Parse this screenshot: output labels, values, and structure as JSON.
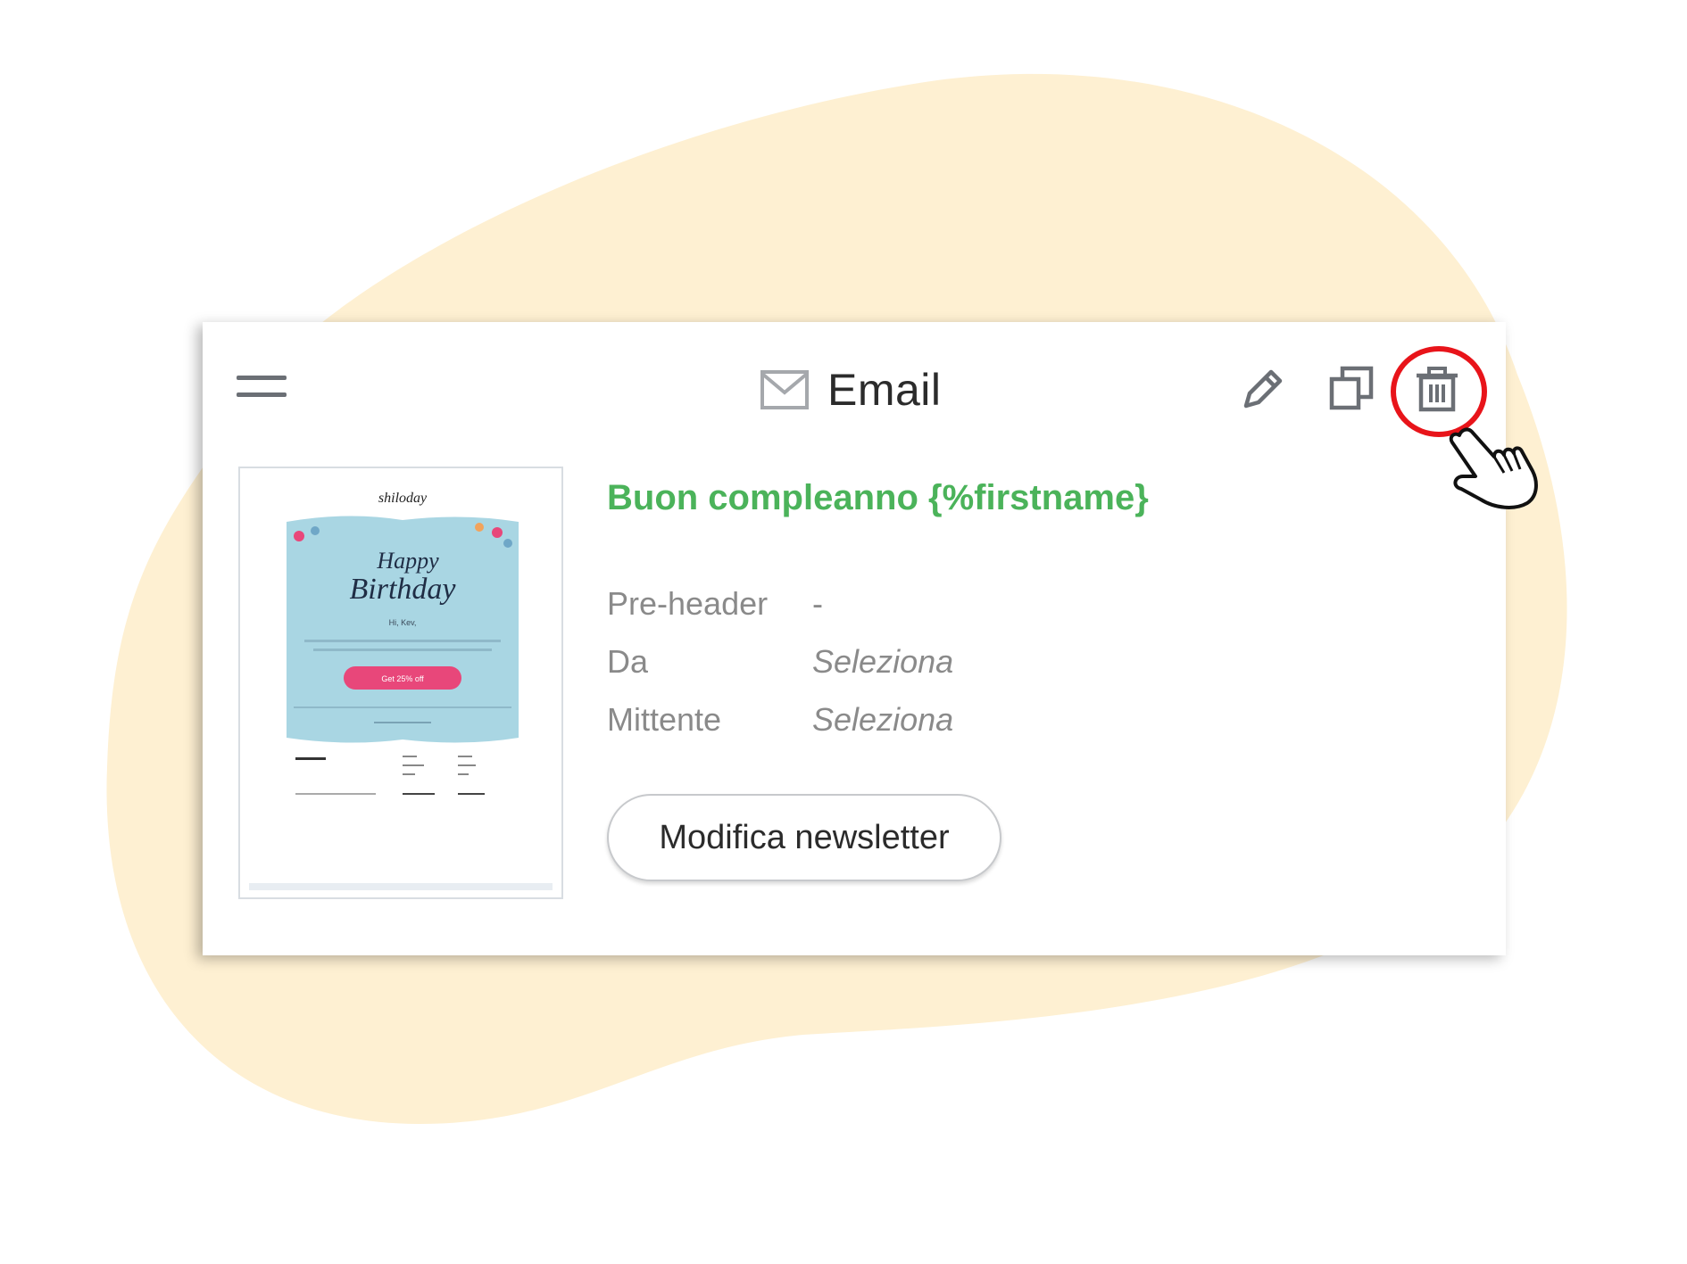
{
  "header": {
    "title": "Email",
    "title_icon": "envelope-icon",
    "drag_icon": "drag-handle-icon",
    "actions": [
      {
        "name": "edit",
        "icon": "pencil-icon"
      },
      {
        "name": "duplicate",
        "icon": "copy-icon"
      },
      {
        "name": "delete",
        "icon": "trash-icon"
      }
    ]
  },
  "annotation": {
    "highlight_color": "#e8141a",
    "cursor_icon": "hand-pointer-icon"
  },
  "email": {
    "subject": "Buon compleanno {%firstname}",
    "subject_color": "#4bb35a",
    "fields": [
      {
        "label": "Pre-header",
        "value": "-"
      },
      {
        "label": "Da",
        "value": "Seleziona"
      },
      {
        "label": "Mittente",
        "value": "Seleziona"
      }
    ],
    "edit_button": "Modifica newsletter"
  },
  "preview": {
    "brand": "shiloday",
    "headline_1": "Happy",
    "headline_2": "Birthday",
    "greeting": "Hi, Kev,",
    "cta": "Get 25% off"
  },
  "colors": {
    "background_blob": "#fef0d2",
    "preview_blue": "#a9d6e3",
    "preview_cta": "#e8477a"
  }
}
